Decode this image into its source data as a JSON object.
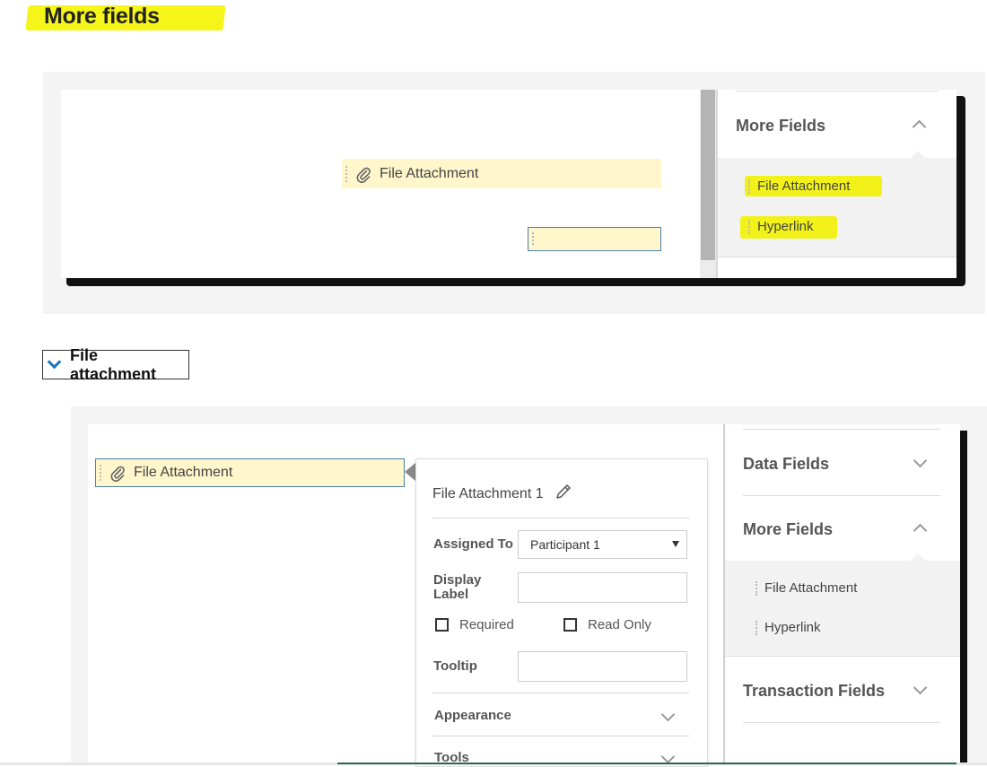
{
  "page_heading": "More fields",
  "screenshot_top": {
    "field_label": "File Attachment",
    "panel_title": "More Fields",
    "items": [
      "File Attachment",
      "Hyperlink"
    ]
  },
  "toggle": {
    "label": "File attachment"
  },
  "screenshot_bottom": {
    "field_label": "File Attachment",
    "popup": {
      "title": "File Attachment 1",
      "assigned_to_label": "Assigned To",
      "assigned_to_value": "Participant 1",
      "display_label_line1": "Display",
      "display_label_line2": "Label",
      "required_label": "Required",
      "read_only_label": "Read Only",
      "tooltip_label": "Tooltip",
      "appearance_label": "Appearance",
      "tools_label": "Tools"
    },
    "sidebar": {
      "data_fields": "Data Fields",
      "more_fields": "More Fields",
      "items": [
        "File Attachment",
        "Hyperlink"
      ],
      "transaction_fields": "Transaction Fields"
    }
  },
  "colors": {
    "highlight": "#f2f21a",
    "field_bg": "#fff6cc",
    "field_border": "#4a7fa8",
    "toggle_chevron": "#1f6fc5"
  },
  "icons": [
    "paperclip-icon",
    "pencil-icon",
    "chevron-up-icon",
    "chevron-down-icon",
    "dropdown-arrow-icon",
    "checkbox-icon"
  ]
}
